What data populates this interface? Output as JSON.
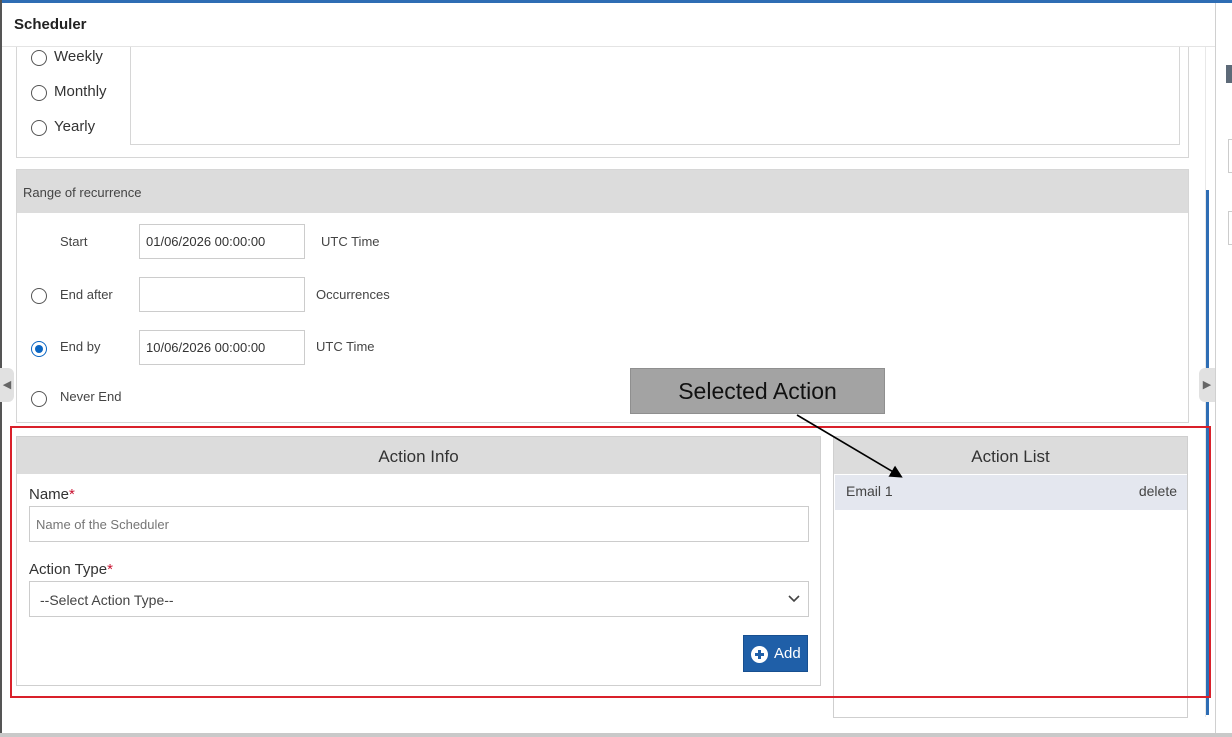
{
  "window": {
    "title": "Scheduler"
  },
  "pattern": {
    "options": [
      {
        "label": "Weekly",
        "selected": false
      },
      {
        "label": "Monthly",
        "selected": false
      },
      {
        "label": "Yearly",
        "selected": false
      }
    ]
  },
  "range": {
    "header": "Range of recurrence",
    "start_label": "Start",
    "start_value": "01/06/2026 00:00:00",
    "start_unit": "UTC Time",
    "end_after_label": "End after",
    "end_after_value": "",
    "end_after_unit": "Occurrences",
    "end_by_label": "End by",
    "end_by_value": "10/06/2026 00:00:00",
    "end_by_unit": "UTC Time",
    "never_end_label": "Never End",
    "selected_option": "End by"
  },
  "action_info": {
    "header": "Action Info",
    "name_label": "Name",
    "name_required": "*",
    "name_placeholder": "Name of the Scheduler",
    "type_label": "Action Type",
    "type_required": "*",
    "type_selected": "--Select Action Type--",
    "add_label": "Add"
  },
  "action_list": {
    "header": "Action List",
    "items": [
      {
        "name": "Email 1",
        "delete_label": "delete"
      }
    ]
  },
  "callout": {
    "text": "Selected Action"
  },
  "colors": {
    "accent": "#1f5fa8",
    "highlight": "#d9202a",
    "header_bg": "#dcdcdc"
  }
}
